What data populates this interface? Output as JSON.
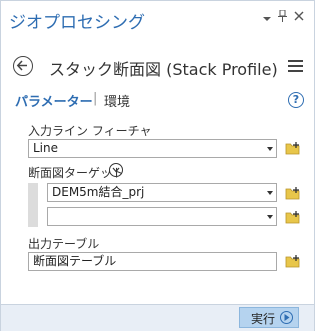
{
  "pane": {
    "title": "ジオプロセシング"
  },
  "tool": {
    "title": "スタック断面図 (Stack Profile)"
  },
  "tabs": {
    "parameters": "パラメーター",
    "separator": "|",
    "environments": "環境"
  },
  "help": {
    "symbol": "?"
  },
  "params": {
    "input_line": {
      "label": "入力ライン フィーチャ",
      "value": "Line"
    },
    "profile_targets": {
      "label": "断面図ターゲット",
      "rows": [
        {
          "value": "DEM5m結合_prj"
        },
        {
          "value": ""
        }
      ]
    },
    "output_table": {
      "label": "出力テーブル",
      "value": "断面図テーブル"
    }
  },
  "footer": {
    "run_label": "実行"
  },
  "colors": {
    "accent": "#2e6db2",
    "folder": "#e8c64a",
    "run_button": "#b5d3ef"
  },
  "icons": {
    "dropdown": "chevron-down-icon",
    "pin": "pin-icon",
    "close": "close-icon",
    "back": "back-arrow-icon",
    "menu": "hamburger-menu-icon",
    "help": "help-icon",
    "browse": "folder-add-icon",
    "expand": "chevron-down-circle-icon",
    "run": "play-icon"
  }
}
